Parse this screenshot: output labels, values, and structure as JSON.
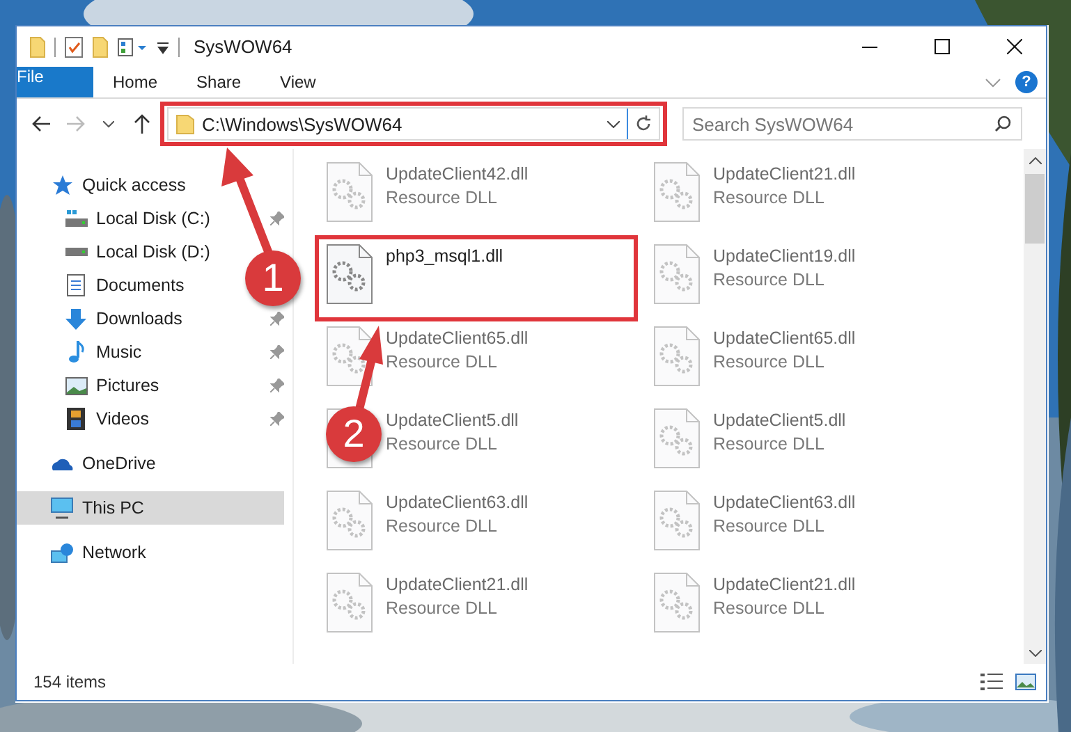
{
  "window": {
    "title": "SysWOW64"
  },
  "ribbon": {
    "tabs": [
      {
        "label": "File",
        "kind": "file"
      },
      {
        "label": "Home",
        "kind": "tab"
      },
      {
        "label": "Share",
        "kind": "tab"
      },
      {
        "label": "View",
        "kind": "tab"
      }
    ],
    "help": "?"
  },
  "address_bar": {
    "path": "C:\\Windows\\SysWOW64"
  },
  "search": {
    "placeholder": "Search SysWOW64"
  },
  "navigation": [
    {
      "label": "Quick access",
      "kind": "star",
      "selected": false,
      "children": [
        {
          "label": "Local Disk (C:)",
          "kind": "system-drive",
          "selected": false,
          "pinned": true
        },
        {
          "label": "Local Disk (D:)",
          "kind": "drive",
          "selected": false,
          "pinned": false
        },
        {
          "label": "Documents",
          "kind": "documents",
          "selected": false,
          "pinned": false
        },
        {
          "label": "Downloads",
          "kind": "downloads",
          "selected": false,
          "pinned": true
        },
        {
          "label": "Music",
          "kind": "music",
          "selected": false,
          "pinned": true
        },
        {
          "label": "Pictures",
          "kind": "pictures",
          "selected": false,
          "pinned": true
        },
        {
          "label": "Videos",
          "kind": "videos",
          "selected": false,
          "pinned": true
        }
      ]
    },
    {
      "label": "OneDrive",
      "kind": "cloud",
      "selected": false
    },
    {
      "label": "This PC",
      "kind": "computer",
      "selected": true
    },
    {
      "label": "Network",
      "kind": "network",
      "selected": false
    }
  ],
  "files": [
    {
      "name": "UpdateClient42.dll",
      "type": "Resource DLL",
      "dimmed": true
    },
    {
      "name": "UpdateClient21.dll",
      "type": "Resource DLL",
      "dimmed": true
    },
    {
      "name": "php3_msql1.dll",
      "dimmed": false
    },
    {
      "name": "UpdateClient19.dll",
      "type": "Resource DLL",
      "dimmed": true
    },
    {
      "name": "UpdateClient65.dll",
      "type": "Resource DLL",
      "dimmed": true
    },
    {
      "name": "UpdateClient65.dll",
      "type": "Resource DLL",
      "dimmed": true
    },
    {
      "name": "UpdateClient5.dll",
      "type": "Resource DLL",
      "dimmed": true
    },
    {
      "name": "UpdateClient5.dll",
      "type": "Resource DLL",
      "dimmed": true
    },
    {
      "name": "UpdateClient63.dll",
      "type": "Resource DLL",
      "dimmed": true
    },
    {
      "name": "UpdateClient63.dll",
      "type": "Resource DLL",
      "dimmed": true
    },
    {
      "name": "UpdateClient21.dll",
      "type": "Resource DLL",
      "dimmed": true
    },
    {
      "name": "UpdateClient21.dll",
      "type": "Resource DLL",
      "dimmed": true
    }
  ],
  "status_bar": {
    "item_count": "154 items"
  },
  "annotations": [
    {
      "label": "1"
    },
    {
      "label": "2"
    }
  ]
}
